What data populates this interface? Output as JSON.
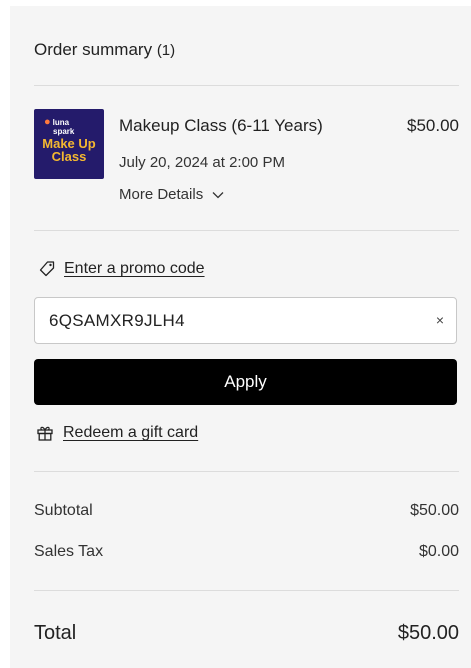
{
  "summary": {
    "title": "Order summary",
    "count": "(1)"
  },
  "item": {
    "thumbnail_brand_line1": "luna",
    "thumbnail_brand_line2": "spark",
    "thumbnail_text_line1": "Make Up",
    "thumbnail_text_line2": "Class",
    "name": "Makeup Class (6-11 Years)",
    "price": "$50.00",
    "date": "July 20, 2024 at 2:00 PM",
    "more_details_label": "More Details"
  },
  "promo": {
    "link_label": "Enter a promo code",
    "input_value": "6QSAMXR9JLH4",
    "clear_glyph": "×",
    "apply_label": "Apply"
  },
  "gift": {
    "link_label": "Redeem a gift card"
  },
  "totals": {
    "subtotal_label": "Subtotal",
    "subtotal_value": "$50.00",
    "tax_label": "Sales Tax",
    "tax_value": "$0.00",
    "total_label": "Total",
    "total_value": "$50.00"
  },
  "colors": {
    "panel_bg": "#f5f5f5",
    "button_bg": "#000000",
    "thumb_bg": "#241b6b",
    "thumb_accent": "#f4b830"
  },
  "icons": {
    "promo": "tag-icon",
    "gift": "gift-icon",
    "expand": "chevron-down-icon",
    "clear": "close-icon"
  }
}
